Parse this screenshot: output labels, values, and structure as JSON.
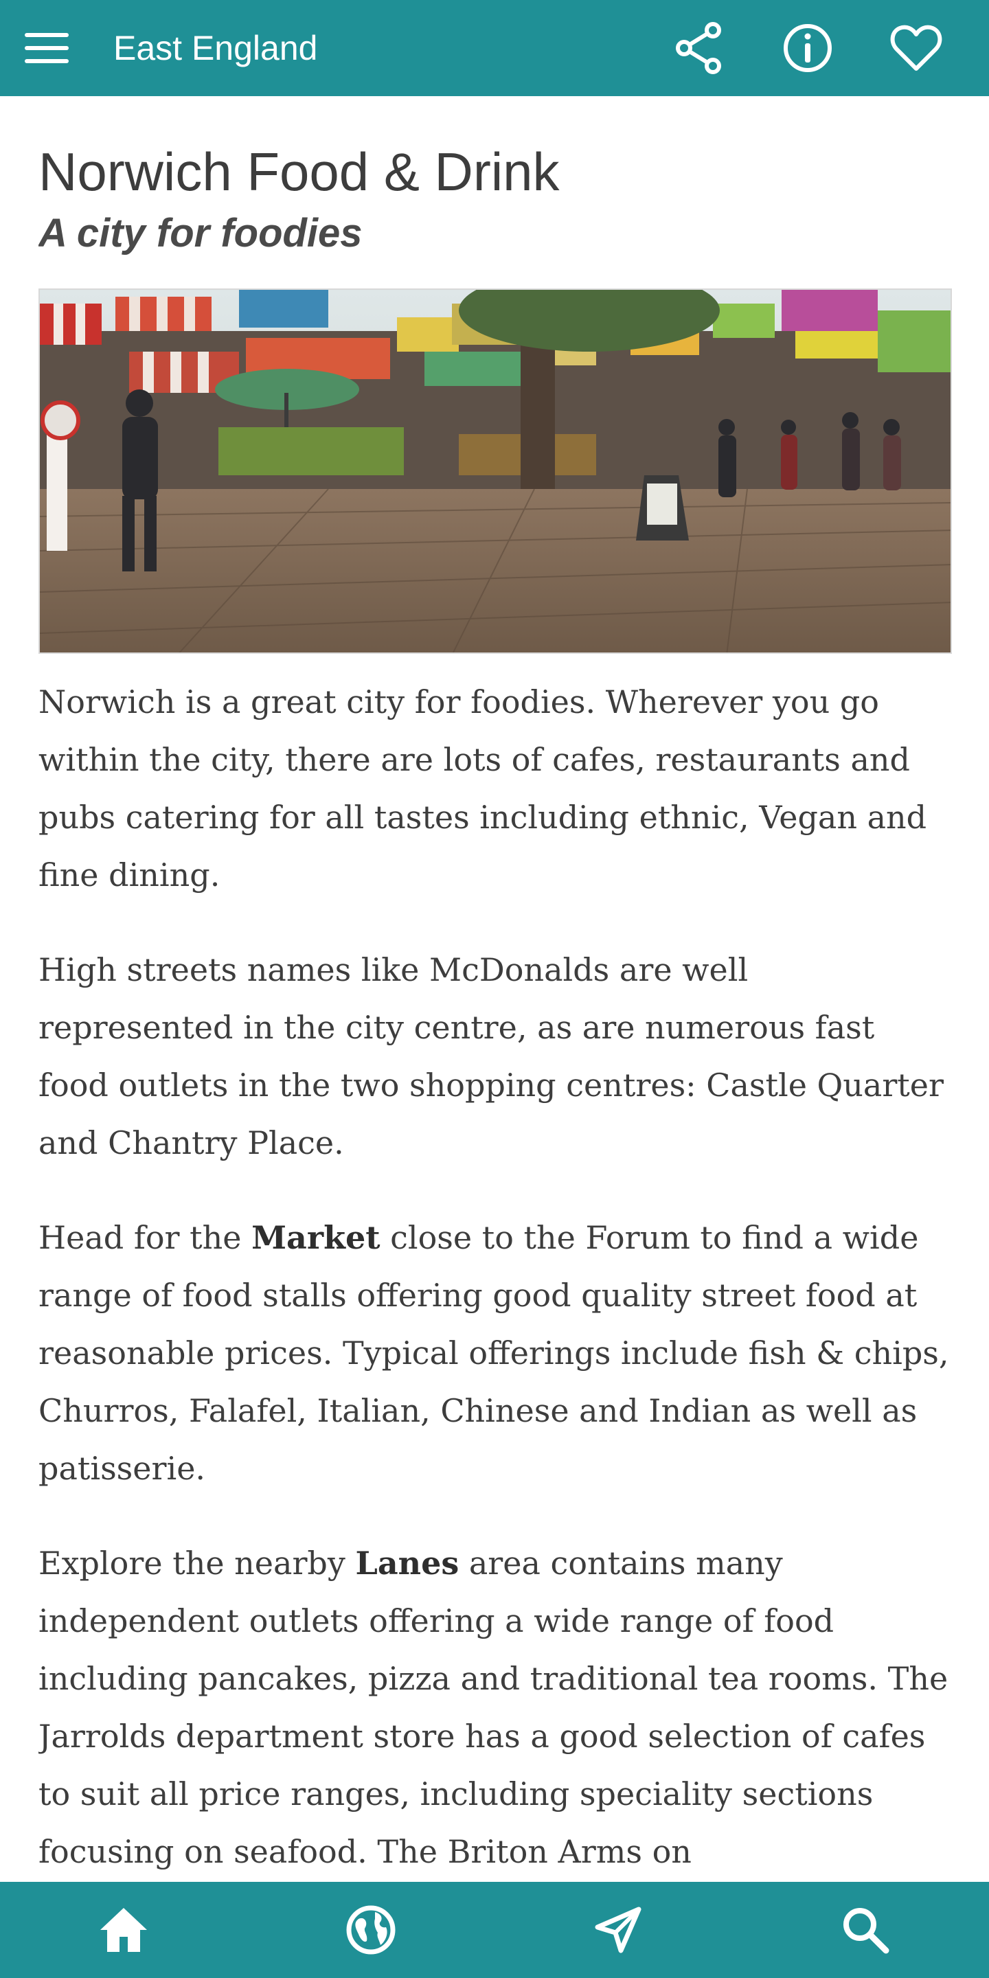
{
  "appbar": {
    "title": "East England",
    "icons": {
      "menu": "hamburger-menu-icon",
      "share": "share-icon",
      "info": "info-icon",
      "favorite": "heart-icon"
    }
  },
  "article": {
    "title": "Norwich Food & Drink",
    "subtitle": "A city for foodies",
    "hero_image": "photo of Norwich outdoor market with striped stall awnings and shoppers",
    "paragraphs": {
      "p1": "Norwich is a great city for foodies. Wherever you go within the city, there are lots of cafes, restaurants and pubs catering for all tastes including ethnic, Vegan and fine dining.",
      "p2": "High streets names like McDonalds are well represented in the city centre, as are numerous fast food outlets in the two shopping centres: Castle Quarter and Chantry Place.",
      "p3_before": "Head for the ",
      "p3_bold": "Market",
      "p3_after": " close to the Forum to find a wide range of food stalls offering good quality street food at reasonable prices. Typical offerings include fish & chips, Churros, Falafel, Italian, Chinese and Indian as well as patisserie.",
      "p4_before": "Explore the nearby ",
      "p4_bold": "Lanes",
      "p4_after": " area contains many independent outlets offering a wide range of food including pancakes, pizza and traditional tea rooms. The Jarrolds department store has a good selection of cafes to suit all price ranges, including speciality sections focusing on seafood. The Briton Arms on"
    }
  },
  "bottom_nav": {
    "items": [
      "home-icon",
      "globe-icon",
      "navigation-arrow-icon",
      "search-icon"
    ]
  },
  "colors": {
    "primary": "#1f9096",
    "text": "#3d3d3d",
    "background": "#ffffff"
  }
}
